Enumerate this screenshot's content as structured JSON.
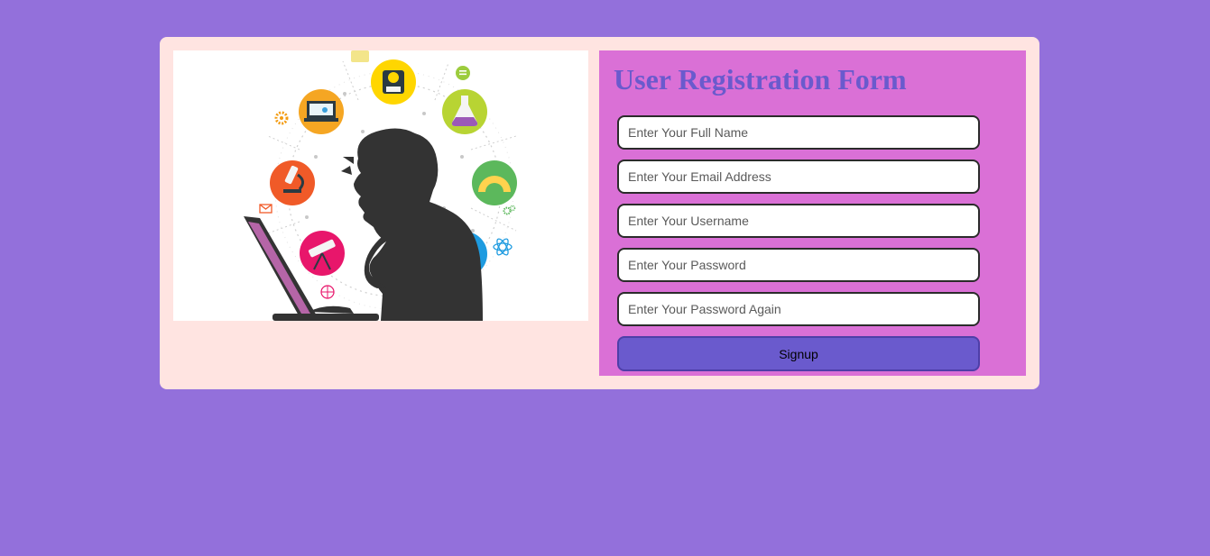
{
  "form": {
    "title": "User Registration Form",
    "fields": [
      {
        "placeholder": "Enter Your Full Name",
        "value": "",
        "type": "text"
      },
      {
        "placeholder": "Enter Your Email Address",
        "value": "",
        "type": "email"
      },
      {
        "placeholder": "Enter Your Username",
        "value": "",
        "type": "text"
      },
      {
        "placeholder": "Enter Your Password",
        "value": "",
        "type": "password"
      },
      {
        "placeholder": "Enter Your Password Again",
        "value": "",
        "type": "password"
      }
    ],
    "signup_label": "Signup"
  },
  "illustration": {
    "icons": [
      "student-icon",
      "flask-icon",
      "protractor-icon",
      "globe-icon",
      "laptop-icon",
      "microscope-icon",
      "telescope-icon",
      "gear-icon",
      "chat-icon",
      "mail-icon",
      "atom-icon",
      "basketball-icon"
    ]
  },
  "colors": {
    "page_background": "#9370db",
    "card_background": "#ffe4e1",
    "form_panel": "#da70d6",
    "title": "#6a5acd",
    "button": "#6a5acd"
  }
}
